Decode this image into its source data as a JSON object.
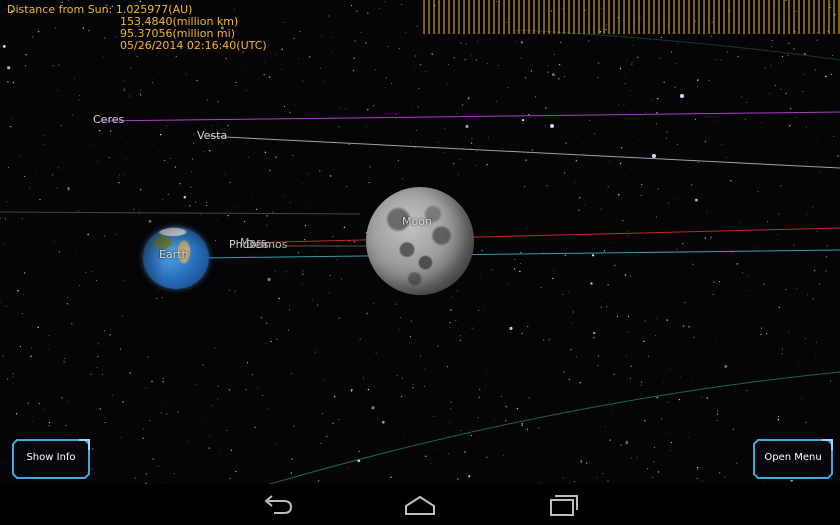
{
  "info": {
    "distance_line": "Distance from Sun: 1.025977(AU)",
    "km_line": "153.4840(million km)",
    "mi_line": "95.37056(million mi)",
    "datetime_line": "05/26/2014 02:16:40(UTC)"
  },
  "bodies": {
    "ceres": "Ceres",
    "vesta": "Vesta",
    "earth": "Earth",
    "moon": "Moon",
    "phobos": "Phobos",
    "mars": "Mars",
    "deimos": "Deimos"
  },
  "buttons": {
    "show_info": "Show Info",
    "open_menu": "Open Menu"
  },
  "icons": {
    "back": "back-arrow-icon",
    "home": "home-icon",
    "recents": "recent-apps-icon"
  },
  "colors": {
    "info_text": "#f2b92a",
    "button_frame": "#3fa8e0",
    "ceres_orbit": "#b03ac8",
    "vesta_orbit": "#c8c8c8",
    "mars_orbit": "#c02828",
    "earth_orbit": "#3a9aa8"
  }
}
